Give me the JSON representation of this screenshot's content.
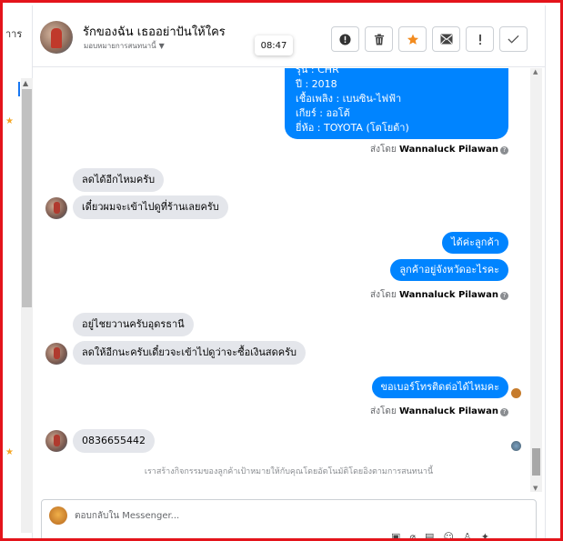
{
  "left_panel": {
    "text": "าาร"
  },
  "header": {
    "contact_name": "รักของฉัน เธออย่าปันให้ใคร",
    "contact_sub": "มอบหมายการสนทนานี้",
    "tooltip_time": "08:47",
    "actions": [
      {
        "name": "report-button",
        "icon": "alert-circle-icon"
      },
      {
        "name": "delete-button",
        "icon": "trash-icon"
      },
      {
        "name": "star-button",
        "icon": "star-icon"
      },
      {
        "name": "mark-unread-button",
        "icon": "envelope-icon"
      },
      {
        "name": "spam-button",
        "icon": "exclamation-icon"
      },
      {
        "name": "done-button",
        "icon": "check-icon"
      }
    ]
  },
  "chat": {
    "car_info_lines": [
      "รุ่น : CHR",
      "ปี : 2018",
      "เชื้อเพลิง : เบนซิน-ไฟฟ้า",
      "เกียร์ : ออโต้",
      "ยี่ห้อ : TOYOTA (โตโยต้า)"
    ],
    "sent_by_prefix": "ส่งโดย",
    "sent_by_name": "Wannaluck Pilawan",
    "msg_in_1": "ลดได้อีกไหมครับ",
    "msg_in_2": "เดี๋ยวผมจะเข้าไปดูที่ร้านเลยครับ",
    "msg_out_1": "ได้ค่ะลูกค้า",
    "msg_out_2": "ลูกค้าอยู่จังหวัดอะไรคะ",
    "msg_in_3": "อยู่ไชยวานครับอุดรธานี",
    "msg_in_4": "ลดให้อีกนะครับเดี๋ยวจะเข้าไปดูว่าจะซื้อเงินสดครับ",
    "msg_out_3": "ขอเบอร์โทรติดต่อได้ไหมคะ",
    "msg_in_5": "0836655442",
    "notice": "เราสร้างกิจกรรมของลูกค้าเป้าหมายให้กับคุณโดยอัตโนมัติโดยอิงตามการสนทนานี้"
  },
  "composer": {
    "placeholder": "ตอบกลับใน Messenger..."
  }
}
